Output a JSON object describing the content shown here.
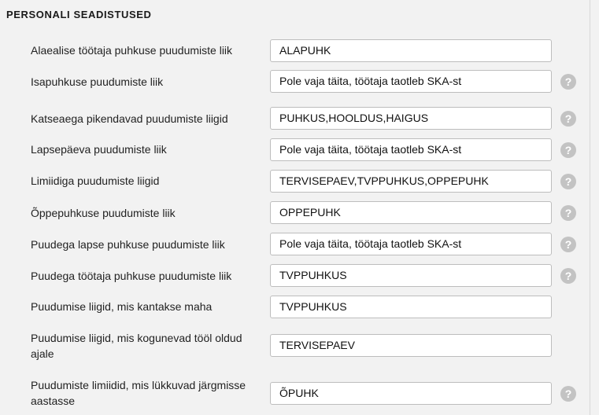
{
  "section": {
    "title": "PERSONALI SEADISTUSED"
  },
  "help_icon_glyph": "?",
  "settings": [
    {
      "label": "Alaealise töötaja puhkuse puudumiste liik",
      "value": "ALAPUHK",
      "help": false
    },
    {
      "label": "Isapuhkuse puudumiste liik",
      "value": "Pole vaja täita, töötaja taotleb SKA-st",
      "help": true
    },
    {
      "label": "Katseaega pikendavad puudumiste liigid",
      "value": "PUHKUS,HOOLDUS,HAIGUS",
      "help": true
    },
    {
      "label": "Lapsepäeva puudumiste liik",
      "value": "Pole vaja täita, töötaja taotleb SKA-st",
      "help": true
    },
    {
      "label": "Limiidiga puudumiste liigid",
      "value": "TERVISEPAEV,TVPPUHKUS,OPPEPUHK",
      "help": true
    },
    {
      "label": "Õppepuhkuse puudumiste liik",
      "value": "OPPEPUHK",
      "help": true
    },
    {
      "label": "Puudega lapse puhkuse puudumiste liik",
      "value": "Pole vaja täita, töötaja taotleb SKA-st",
      "help": true
    },
    {
      "label": "Puudega töötaja puhkuse puudumiste liik",
      "value": "TVPPUHKUS",
      "help": true
    },
    {
      "label": "Puudumise liigid, mis kantakse maha",
      "value": "TVPPUHKUS",
      "help": false
    },
    {
      "label": "Puudumise liigid, mis kogunevad tööl oldud ajale",
      "value": "TERVISEPAEV",
      "help": false
    },
    {
      "label": "Puudumiste limiidid, mis lükkuvad järgmisse aastasse",
      "value": "ÕPUHK",
      "help": true
    }
  ]
}
